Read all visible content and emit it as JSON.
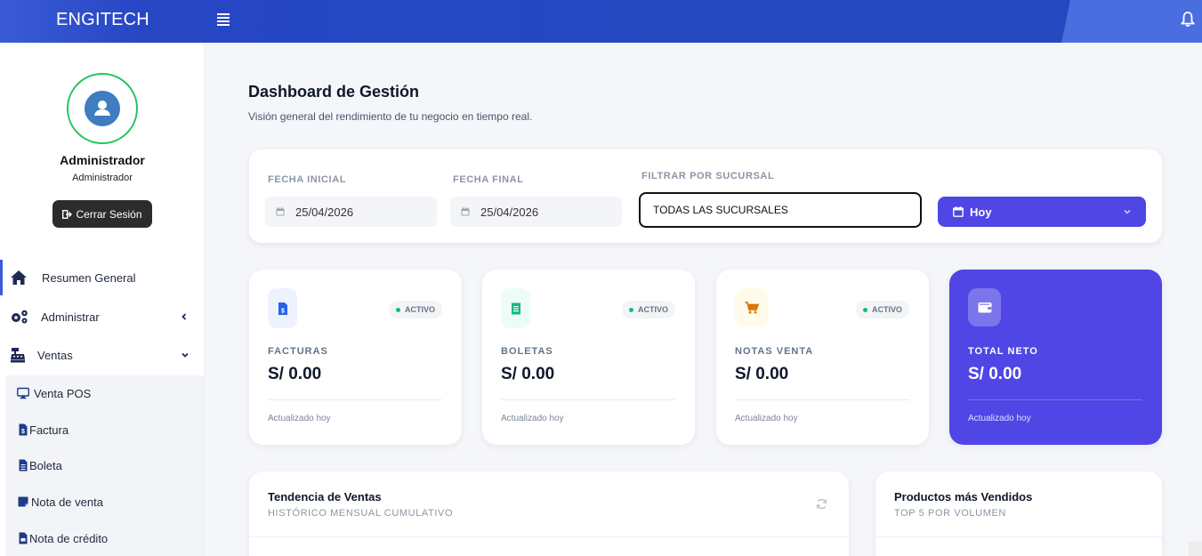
{
  "topbar": {
    "brand": "ENGITECH",
    "menu_icon": "bars-icon",
    "notification_icon": "bell-icon"
  },
  "user": {
    "name": "Administrador",
    "role": "Administrador",
    "logout_label": "Cerrar Sesión"
  },
  "sidebar": {
    "items": [
      {
        "label": "Resumen General",
        "icon": "home-icon"
      },
      {
        "label": "Administrar",
        "icon": "cogs-icon"
      },
      {
        "label": "Ventas",
        "icon": "cash-register-icon"
      }
    ],
    "submenu": [
      {
        "label": "Venta POS",
        "icon": "desktop-icon"
      },
      {
        "label": "Factura",
        "icon": "invoice-icon"
      },
      {
        "label": "Boleta",
        "icon": "file-icon"
      },
      {
        "label": "Nota de venta",
        "icon": "sticky-note-icon"
      },
      {
        "label": "Nota de crédito",
        "icon": "file-invoice-icon"
      }
    ]
  },
  "main": {
    "title": "Dashboard de Gestión",
    "subtitle": "Visión general del rendimiento de tu negocio en tiempo real."
  },
  "filters": {
    "start_label": "FECHA INICIAL",
    "start_value": "25/04/2026",
    "end_label": "FECHA FINAL",
    "end_value": "25/04/2026",
    "branch_label": "FILTRAR POR SUCURSAL",
    "branch_value": "TODAS LAS SUCURSALES",
    "period_value": "Hoy"
  },
  "stats": [
    {
      "title": "FACTURAS",
      "value": "S/ 0.00",
      "badge": "ACTIVO",
      "footer": "Actualizado hoy",
      "icon": "invoice-dollar-icon",
      "color": "#2563eb",
      "bg": "#eef2ff"
    },
    {
      "title": "BOLETAS",
      "value": "S/ 0.00",
      "badge": "ACTIVO",
      "footer": "Actualizado hoy",
      "icon": "receipt-icon",
      "color": "#10b981",
      "bg": "#ecfdf5"
    },
    {
      "title": "NOTAS VENTA",
      "value": "S/ 0.00",
      "badge": "ACTIVO",
      "footer": "Actualizado hoy",
      "icon": "cart-icon",
      "color": "#d97706",
      "bg": "#fffbeb"
    },
    {
      "title": "TOTAL NETO",
      "value": "S/ 0.00",
      "footer": "Actualizado hoy",
      "icon": "wallet-icon",
      "color": "#4f46e5"
    }
  ],
  "panels": {
    "trend_title": "Tendencia de Ventas",
    "trend_subtitle": "HISTÓRICO MENSUAL CUMULATIVO",
    "products_title": "Productos más Vendidos",
    "products_subtitle": "TOP 5 POR VOLUMEN"
  }
}
